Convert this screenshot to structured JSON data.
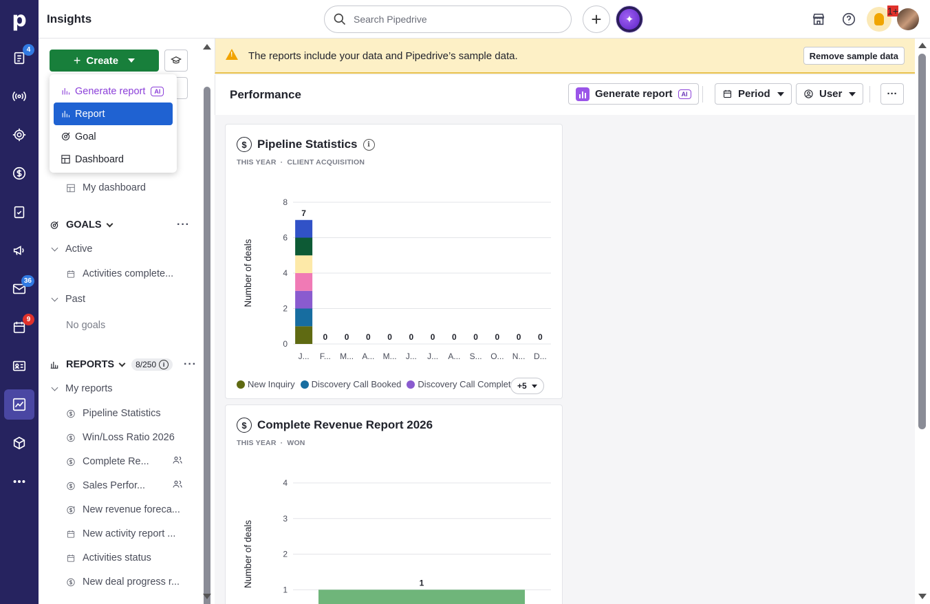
{
  "app": {
    "logo_letter": "p",
    "title": "Insights"
  },
  "rail": {
    "badges": {
      "leads": "4",
      "mail": "36",
      "activities": "9"
    },
    "items": [
      "leads-icon",
      "broadcast-icon",
      "target-icon",
      "dollar-icon",
      "clipboard-icon",
      "megaphone-icon",
      "mail-icon",
      "calendar-icon",
      "contacts-icon",
      "insights-icon",
      "box-icon",
      "more-icon"
    ]
  },
  "topbar": {
    "search_placeholder": "Search Pipedrive",
    "notifications_badge": "1+"
  },
  "sidebar": {
    "create_label": "Create",
    "dashboard_item": "My dashboard",
    "goals_title": "GOALS",
    "goals_active": "Active",
    "goals_active_item": "Activities complete...",
    "goals_past": "Past",
    "goals_empty": "No goals",
    "reports_title": "REPORTS",
    "reports_count": "8/250",
    "my_reports": "My reports",
    "reports": [
      "Pipeline Statistics",
      "Win/Loss Ratio 2026",
      "Complete Re...",
      "Sales Perfor...",
      "New revenue foreca...",
      "New activity report ...",
      "Activities status",
      "New deal progress r..."
    ]
  },
  "dropdown": {
    "items": [
      {
        "label": "Generate report",
        "tag": "AI"
      },
      {
        "label": "Report"
      },
      {
        "label": "Goal"
      },
      {
        "label": "Dashboard"
      }
    ]
  },
  "banner": {
    "message": "The reports include your data and Pipedrive’s sample data.",
    "remove_label": "Remove sample data"
  },
  "dashboard": {
    "title": "Performance",
    "generate_label": "Generate report",
    "generate_tag": "AI",
    "period_label": "Period",
    "user_label": "User",
    "more_label": "···"
  },
  "cards": [
    {
      "title": "Pipeline Statistics",
      "sub1": "THIS YEAR",
      "sub2": "CLIENT ACQUISITION",
      "legend_more": "+5"
    },
    {
      "title": "Complete Revenue Report 2026",
      "sub1": "THIS YEAR",
      "sub2": "WON"
    }
  ],
  "chart_data": [
    {
      "type": "bar",
      "stacked": true,
      "ylabel": "Number of deals",
      "ylim": [
        0,
        8
      ],
      "yticks": [
        0,
        2,
        4,
        6,
        8
      ],
      "categories": [
        "J...",
        "F...",
        "M...",
        "A...",
        "M...",
        "J...",
        "J...",
        "A...",
        "S...",
        "O...",
        "N...",
        "D..."
      ],
      "totals": [
        7,
        0,
        0,
        0,
        0,
        0,
        0,
        0,
        0,
        0,
        0,
        0
      ],
      "series": [
        {
          "name": "New Inquiry",
          "color": "#5f6a12",
          "values": [
            1,
            0,
            0,
            0,
            0,
            0,
            0,
            0,
            0,
            0,
            0,
            0
          ]
        },
        {
          "name": "Discovery Call Booked",
          "color": "#176da0",
          "values": [
            1,
            0,
            0,
            0,
            0,
            0,
            0,
            0,
            0,
            0,
            0,
            0
          ]
        },
        {
          "name": "Discovery Call Complete",
          "color": "#8a5bcf",
          "values": [
            1,
            0,
            0,
            0,
            0,
            0,
            0,
            0,
            0,
            0,
            0,
            0
          ]
        },
        {
          "color": "#f07ab5",
          "values": [
            1,
            0,
            0,
            0,
            0,
            0,
            0,
            0,
            0,
            0,
            0,
            0
          ]
        },
        {
          "color": "#fde9a8",
          "values": [
            1,
            0,
            0,
            0,
            0,
            0,
            0,
            0,
            0,
            0,
            0,
            0
          ]
        },
        {
          "color": "#0d5a35",
          "values": [
            1,
            0,
            0,
            0,
            0,
            0,
            0,
            0,
            0,
            0,
            0,
            0
          ]
        },
        {
          "color": "#3152c7",
          "values": [
            1,
            0,
            0,
            0,
            0,
            0,
            0,
            0,
            0,
            0,
            0,
            0
          ]
        }
      ],
      "legend_placement": "bottom",
      "grid": true
    },
    {
      "type": "bar",
      "ylabel": "Number of deals",
      "ylim": [
        0,
        4
      ],
      "yticks": [
        1,
        2,
        3,
        4
      ],
      "values": [
        1
      ],
      "color": "#6fb57a",
      "grid": true
    }
  ]
}
